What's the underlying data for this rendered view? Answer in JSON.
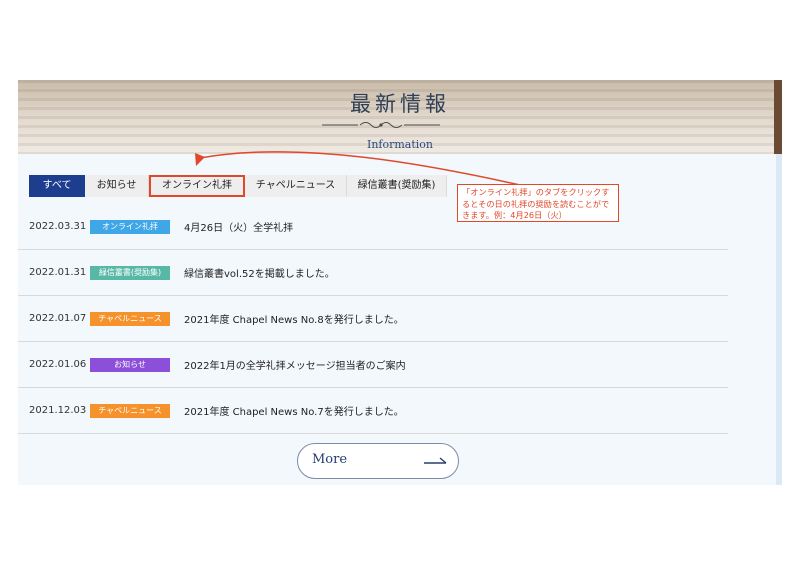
{
  "header": {
    "title": "最新情報",
    "subtitle": "Information"
  },
  "tabs": [
    {
      "label": "すべて",
      "active": true
    },
    {
      "label": "お知らせ"
    },
    {
      "label": "オンライン礼拝",
      "highlighted": true
    },
    {
      "label": "チャペルニュース"
    },
    {
      "label": "緑信叢書(奨励集)"
    }
  ],
  "news": [
    {
      "date": "2022.03.31",
      "category": "オンライン礼拝",
      "category_color": "#3fa7e8",
      "title": "4月26日（火）全学礼拝"
    },
    {
      "date": "2022.01.31",
      "category": "緑信叢書(奨励集)",
      "category_color": "#58b8a6",
      "title": "緑信叢書vol.52を掲載しました。"
    },
    {
      "date": "2022.01.07",
      "category": "チャペルニュース",
      "category_color": "#f5922b",
      "title": "2021年度 Chapel News No.8を発行しました。"
    },
    {
      "date": "2022.01.06",
      "category": "お知らせ",
      "category_color": "#8b4fd9",
      "title": "2022年1月の全学礼拝メッセージ担当者のご案内"
    },
    {
      "date": "2021.12.03",
      "category": "チャペルニュース",
      "category_color": "#f5922b",
      "title": "2021年度 Chapel News No.7を発行しました。"
    }
  ],
  "more_button": {
    "label": "More",
    "icon": "arrow-right-icon"
  },
  "annotation": {
    "text": "「オンライン礼拝」のタブをクリックするとその日の礼拝の奨励を読むことができます。例：4月26日（火）",
    "color": "#e1472a"
  }
}
